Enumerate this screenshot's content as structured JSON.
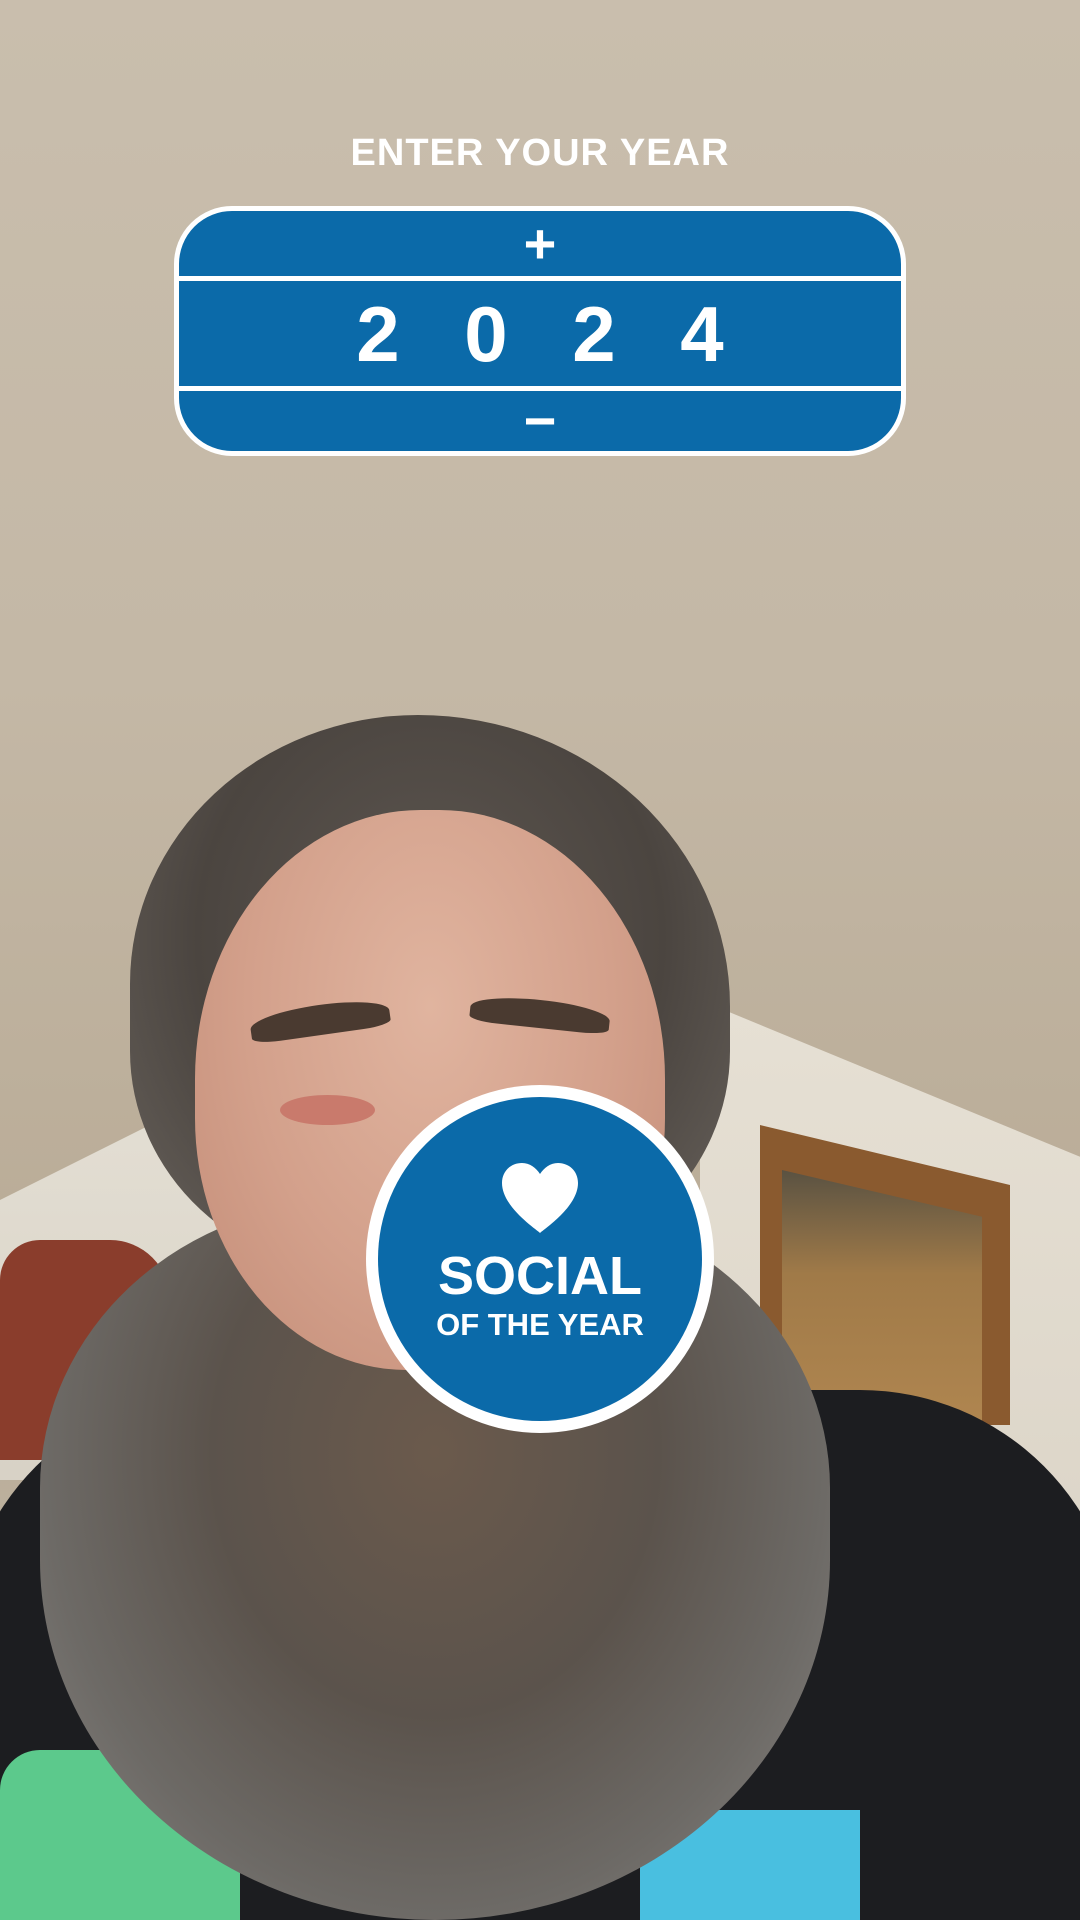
{
  "prompt": {
    "label": "ENTER YOUR YEAR"
  },
  "year_picker": {
    "increment_label": "+",
    "decrement_label": "−",
    "digits": [
      "2",
      "0",
      "2",
      "4"
    ]
  },
  "badge": {
    "icon": "heart-icon",
    "title": "SOCIAL",
    "subtitle": "OF THE YEAR"
  },
  "colors": {
    "accent": "#0b6aa9",
    "foreground": "#ffffff"
  }
}
